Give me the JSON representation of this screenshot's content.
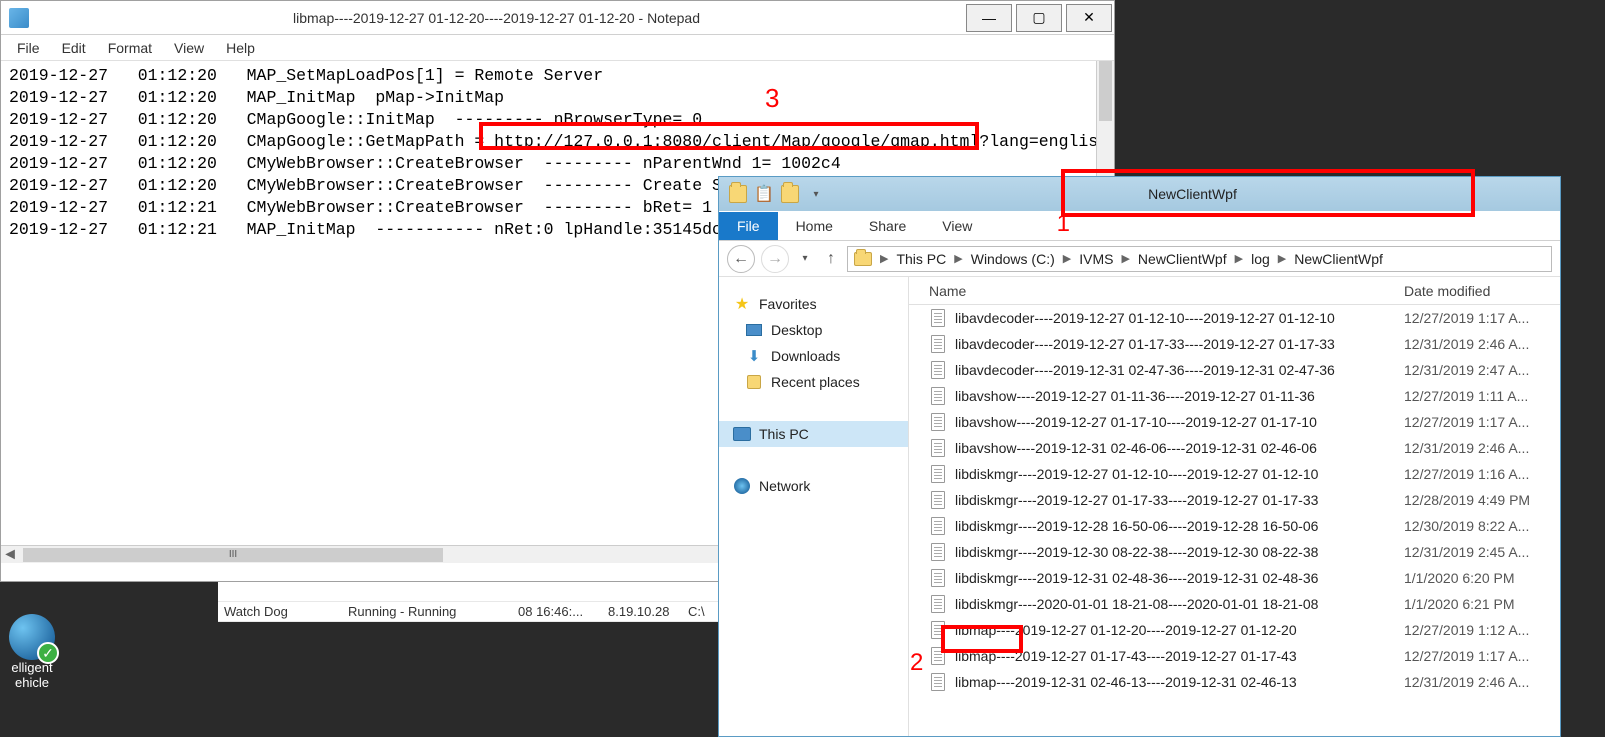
{
  "notepad": {
    "title": "libmap----2019-12-27 01-12-20----2019-12-27 01-12-20 - Notepad",
    "menu": [
      "File",
      "Edit",
      "Format",
      "View",
      "Help"
    ],
    "text": "2019-12-27   01:12:20   MAP_SetMapLoadPos[1] = Remote Server\n2019-12-27   01:12:20   MAP_InitMap  pMap->InitMap\n2019-12-27   01:12:20   CMapGoogle::InitMap  --------- nBrowserType= 0\n2019-12-27   01:12:20   CMapGoogle::GetMapPath = http://127.0.0.1:8080/client/Map/google/gmap.html?lang=englis\n2019-12-27   01:12:20   CMyWebBrowser::CreateBrowser  --------- nParentWnd 1= 1002c4\n2019-12-27   01:12:20   CMyWebBrowser::CreateBrowser  --------- Create S\n2019-12-27   01:12:21   CMyWebBrowser::CreateBrowser  --------- bRet= 1\n2019-12-27   01:12:21   MAP_InitMap  ----------- nRet:0 lpHandle:35145dc",
    "highlight_url": "http://127.0.0.1:8080/client/Map/google/gmap.html",
    "annotation": "3",
    "scroll_label": "III"
  },
  "bgApp": {
    "row1": {
      "c1": "",
      "c2": "",
      "c3": "",
      "c4": "",
      "c5": ""
    },
    "row2": {
      "c1": "Watch Dog",
      "c2": "Running - Running",
      "c3": "08 16:46:...",
      "c4": "8.19.10.28",
      "c5": "C:\\"
    }
  },
  "desktopIcon": {
    "line1": "elligent",
    "line2": "ehicle"
  },
  "explorer": {
    "title": "NewClientWpf",
    "tabs": {
      "file": "File",
      "home": "Home",
      "share": "Share",
      "view": "View"
    },
    "breadcrumb": [
      "This PC",
      "Windows (C:)",
      "IVMS",
      "NewClientWpf",
      "log",
      "NewClientWpf"
    ],
    "annotation1": "1",
    "annotation2": "2",
    "nav": {
      "favorites": "Favorites",
      "desktop": "Desktop",
      "downloads": "Downloads",
      "recent": "Recent places",
      "thispc": "This PC",
      "network": "Network"
    },
    "columns": {
      "name": "Name",
      "date": "Date modified"
    },
    "files": [
      {
        "name": "libavdecoder----2019-12-27 01-12-10----2019-12-27 01-12-10",
        "date": "12/27/2019 1:17 A..."
      },
      {
        "name": "libavdecoder----2019-12-27 01-17-33----2019-12-27 01-17-33",
        "date": "12/31/2019 2:46 A..."
      },
      {
        "name": "libavdecoder----2019-12-31 02-47-36----2019-12-31 02-47-36",
        "date": "12/31/2019 2:47 A..."
      },
      {
        "name": "libavshow----2019-12-27 01-11-36----2019-12-27 01-11-36",
        "date": "12/27/2019 1:11 A..."
      },
      {
        "name": "libavshow----2019-12-27 01-17-10----2019-12-27 01-17-10",
        "date": "12/27/2019 1:17 A..."
      },
      {
        "name": "libavshow----2019-12-31 02-46-06----2019-12-31 02-46-06",
        "date": "12/31/2019 2:46 A..."
      },
      {
        "name": "libdiskmgr----2019-12-27 01-12-10----2019-12-27 01-12-10",
        "date": "12/27/2019 1:16 A..."
      },
      {
        "name": "libdiskmgr----2019-12-27 01-17-33----2019-12-27 01-17-33",
        "date": "12/28/2019 4:49 PM"
      },
      {
        "name": "libdiskmgr----2019-12-28 16-50-06----2019-12-28 16-50-06",
        "date": "12/30/2019 8:22 A..."
      },
      {
        "name": "libdiskmgr----2019-12-30 08-22-38----2019-12-30 08-22-38",
        "date": "12/31/2019 2:45 A..."
      },
      {
        "name": "libdiskmgr----2019-12-31 02-48-36----2019-12-31 02-48-36",
        "date": "1/1/2020 6:20 PM"
      },
      {
        "name": "libdiskmgr----2020-01-01 18-21-08----2020-01-01 18-21-08",
        "date": "1/1/2020 6:21 PM"
      },
      {
        "name": "libmap----2019-12-27 01-12-20----2019-12-27 01-12-20",
        "date": "12/27/2019 1:12 A..."
      },
      {
        "name": "libmap----2019-12-27 01-17-43----2019-12-27 01-17-43",
        "date": "12/27/2019 1:17 A..."
      },
      {
        "name": "libmap----2019-12-31 02-46-13----2019-12-31 02-46-13",
        "date": "12/31/2019 2:46 A..."
      }
    ]
  }
}
